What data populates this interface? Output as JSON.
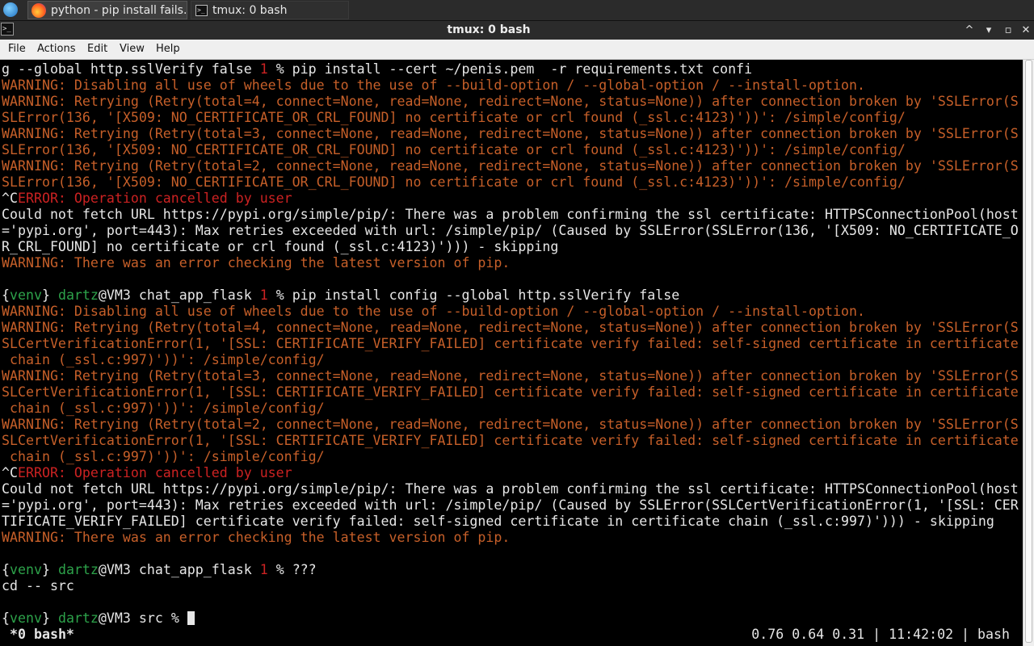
{
  "taskbar": {
    "tasks": [
      {
        "label": "python - pip install fails..."
      },
      {
        "label": "tmux: 0 bash"
      }
    ]
  },
  "window": {
    "title": "tmux: 0 bash"
  },
  "menubar": {
    "items": [
      "File",
      "Actions",
      "Edit",
      "View",
      "Help"
    ]
  },
  "terminal": {
    "lines": [
      {
        "segments": [
          {
            "text": "g --global http.sslVerify false ",
            "c": ""
          },
          {
            "text": "1",
            "c": "r"
          },
          {
            "text": " % pip install --cert ~/penis.pem  -r requirements.txt confi",
            "c": ""
          }
        ]
      },
      {
        "segments": [
          {
            "text": "WARNING: Disabling all use of wheels due to the use of --build-option / --global-option / --install-option.",
            "c": "w"
          }
        ]
      },
      {
        "segments": [
          {
            "text": "WARNING: Retrying (Retry(total=4, connect=None, read=None, redirect=None, status=None)) after connection broken by 'SSLError(S",
            "c": "w"
          }
        ]
      },
      {
        "segments": [
          {
            "text": "SLError(136, '[X509: NO_CERTIFICATE_OR_CRL_FOUND] no certificate or crl found (_ssl.c:4123)'))': /simple/config/",
            "c": "w"
          }
        ]
      },
      {
        "segments": [
          {
            "text": "WARNING: Retrying (Retry(total=3, connect=None, read=None, redirect=None, status=None)) after connection broken by 'SSLError(S",
            "c": "w"
          }
        ]
      },
      {
        "segments": [
          {
            "text": "SLError(136, '[X509: NO_CERTIFICATE_OR_CRL_FOUND] no certificate or crl found (_ssl.c:4123)'))': /simple/config/",
            "c": "w"
          }
        ]
      },
      {
        "segments": [
          {
            "text": "WARNING: Retrying (Retry(total=2, connect=None, read=None, redirect=None, status=None)) after connection broken by 'SSLError(S",
            "c": "w"
          }
        ]
      },
      {
        "segments": [
          {
            "text": "SLError(136, '[X509: NO_CERTIFICATE_OR_CRL_FOUND] no certificate or crl found (_ssl.c:4123)'))': /simple/config/",
            "c": "w"
          }
        ]
      },
      {
        "segments": [
          {
            "text": "^C",
            "c": ""
          },
          {
            "text": "ERROR: Operation cancelled by user",
            "c": "r"
          }
        ]
      },
      {
        "segments": [
          {
            "text": "Could not fetch URL https://pypi.org/simple/pip/: There was a problem confirming the ssl certificate: HTTPSConnectionPool(host",
            "c": ""
          }
        ]
      },
      {
        "segments": [
          {
            "text": "='pypi.org', port=443): Max retries exceeded with url: /simple/pip/ (Caused by SSLError(SSLError(136, '[X509: NO_CERTIFICATE_O",
            "c": ""
          }
        ]
      },
      {
        "segments": [
          {
            "text": "R_CRL_FOUND] no certificate or crl found (_ssl.c:4123)'))) - skipping",
            "c": ""
          }
        ]
      },
      {
        "segments": [
          {
            "text": "WARNING: There was an error checking the latest version of pip.",
            "c": "w"
          }
        ]
      },
      {
        "segments": [
          {
            "text": "",
            "c": ""
          }
        ]
      },
      {
        "segments": [
          {
            "text": "{",
            "c": ""
          },
          {
            "text": "venv",
            "c": "g"
          },
          {
            "text": "} ",
            "c": ""
          },
          {
            "text": "dartz",
            "c": "g"
          },
          {
            "text": "@VM3 chat_app_flask ",
            "c": ""
          },
          {
            "text": "1",
            "c": "r"
          },
          {
            "text": " % pip install config --global http.sslVerify false",
            "c": ""
          }
        ]
      },
      {
        "segments": [
          {
            "text": "WARNING: Disabling all use of wheels due to the use of --build-option / --global-option / --install-option.",
            "c": "w"
          }
        ]
      },
      {
        "segments": [
          {
            "text": "WARNING: Retrying (Retry(total=4, connect=None, read=None, redirect=None, status=None)) after connection broken by 'SSLError(S",
            "c": "w"
          }
        ]
      },
      {
        "segments": [
          {
            "text": "SLCertVerificationError(1, '[SSL: CERTIFICATE_VERIFY_FAILED] certificate verify failed: self-signed certificate in certificate",
            "c": "w"
          }
        ]
      },
      {
        "segments": [
          {
            "text": " chain (_ssl.c:997)'))': /simple/config/",
            "c": "w"
          }
        ]
      },
      {
        "segments": [
          {
            "text": "WARNING: Retrying (Retry(total=3, connect=None, read=None, redirect=None, status=None)) after connection broken by 'SSLError(S",
            "c": "w"
          }
        ]
      },
      {
        "segments": [
          {
            "text": "SLCertVerificationError(1, '[SSL: CERTIFICATE_VERIFY_FAILED] certificate verify failed: self-signed certificate in certificate",
            "c": "w"
          }
        ]
      },
      {
        "segments": [
          {
            "text": " chain (_ssl.c:997)'))': /simple/config/",
            "c": "w"
          }
        ]
      },
      {
        "segments": [
          {
            "text": "WARNING: Retrying (Retry(total=2, connect=None, read=None, redirect=None, status=None)) after connection broken by 'SSLError(S",
            "c": "w"
          }
        ]
      },
      {
        "segments": [
          {
            "text": "SLCertVerificationError(1, '[SSL: CERTIFICATE_VERIFY_FAILED] certificate verify failed: self-signed certificate in certificate",
            "c": "w"
          }
        ]
      },
      {
        "segments": [
          {
            "text": " chain (_ssl.c:997)'))': /simple/config/",
            "c": "w"
          }
        ]
      },
      {
        "segments": [
          {
            "text": "^C",
            "c": ""
          },
          {
            "text": "ERROR: Operation cancelled by user",
            "c": "r"
          }
        ]
      },
      {
        "segments": [
          {
            "text": "Could not fetch URL https://pypi.org/simple/pip/: There was a problem confirming the ssl certificate: HTTPSConnectionPool(host",
            "c": ""
          }
        ]
      },
      {
        "segments": [
          {
            "text": "='pypi.org', port=443): Max retries exceeded with url: /simple/pip/ (Caused by SSLError(SSLCertVerificationError(1, '[SSL: CER",
            "c": ""
          }
        ]
      },
      {
        "segments": [
          {
            "text": "TIFICATE_VERIFY_FAILED] certificate verify failed: self-signed certificate in certificate chain (_ssl.c:997)'))) - skipping",
            "c": ""
          }
        ]
      },
      {
        "segments": [
          {
            "text": "WARNING: There was an error checking the latest version of pip.",
            "c": "w"
          }
        ]
      },
      {
        "segments": [
          {
            "text": "",
            "c": ""
          }
        ]
      },
      {
        "segments": [
          {
            "text": "{",
            "c": ""
          },
          {
            "text": "venv",
            "c": "g"
          },
          {
            "text": "} ",
            "c": ""
          },
          {
            "text": "dartz",
            "c": "g"
          },
          {
            "text": "@VM3 chat_app_flask ",
            "c": ""
          },
          {
            "text": "1",
            "c": "r"
          },
          {
            "text": " % ???",
            "c": ""
          }
        ]
      },
      {
        "segments": [
          {
            "text": "cd -- src",
            "c": ""
          }
        ]
      },
      {
        "segments": [
          {
            "text": "",
            "c": ""
          }
        ]
      },
      {
        "segments": [
          {
            "text": "{",
            "c": ""
          },
          {
            "text": "venv",
            "c": "g"
          },
          {
            "text": "} ",
            "c": ""
          },
          {
            "text": "dartz",
            "c": "g"
          },
          {
            "text": "@VM3 src % ",
            "c": ""
          }
        ],
        "cursor": true
      }
    ]
  },
  "statusbar": {
    "window": "*0 bash*",
    "right": "0.76 0.64 0.31 | 11:42:02 | bash"
  },
  "colors": {
    "warning": "#c65f29",
    "error": "#cc2222",
    "prompt_green": "#2da24a",
    "terminal_bg": "#000000"
  }
}
